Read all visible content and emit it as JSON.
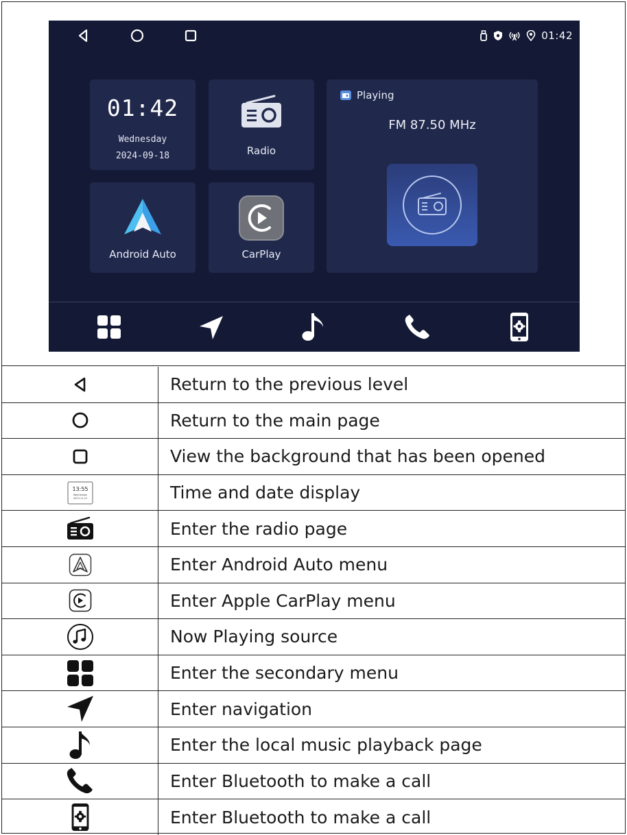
{
  "screen": {
    "status": {
      "time": "01:42",
      "icons": [
        "usb-icon",
        "shield-icon",
        "wireless-icon",
        "location-icon"
      ]
    },
    "nav_buttons": [
      "back-icon",
      "home-icon",
      "recents-icon"
    ],
    "clock_tile": {
      "time": "01:42",
      "day": "Wednesday",
      "date": "2024-09-18"
    },
    "radio_tile": {
      "label": "Radio"
    },
    "android_auto_tile": {
      "label": "Android Auto"
    },
    "carplay_tile": {
      "label": "CarPlay"
    },
    "now_playing": {
      "status": "Playing",
      "station": "FM 87.50 MHz"
    },
    "dock": [
      "apps-grid-icon",
      "navigation-icon",
      "music-note-icon",
      "phone-icon",
      "phone-settings-icon"
    ],
    "colors": {
      "screen_bg": "#141a36",
      "tile_bg": "#20284c",
      "accent": "#3a5ab0"
    }
  },
  "legend": {
    "rows": [
      {
        "icon": "back-icon",
        "text": "Return to the previous level"
      },
      {
        "icon": "home-icon",
        "text": "Return to the main page"
      },
      {
        "icon": "recents-icon",
        "text": "View the background that has been opened"
      },
      {
        "icon": "clock-widget-icon",
        "text": "Time and date display",
        "widget_time": "13:55",
        "widget_day": "Wednesday",
        "widget_date": "2023-11-21"
      },
      {
        "icon": "radio-icon",
        "text": "Enter the radio page"
      },
      {
        "icon": "android-auto-icon",
        "text": "Enter Android Auto menu"
      },
      {
        "icon": "carplay-icon",
        "text": "Enter Apple CarPlay menu"
      },
      {
        "icon": "now-playing-icon",
        "text": "Now Playing source"
      },
      {
        "icon": "apps-grid-icon",
        "text": "Enter the secondary menu"
      },
      {
        "icon": "navigation-icon",
        "text": "Enter navigation"
      },
      {
        "icon": "music-note-icon",
        "text": "Enter the local music playback page"
      },
      {
        "icon": "phone-icon",
        "text": "Enter Bluetooth to make a call"
      },
      {
        "icon": "phone-settings-icon",
        "text": "Enter Bluetooth to make a call"
      }
    ]
  }
}
